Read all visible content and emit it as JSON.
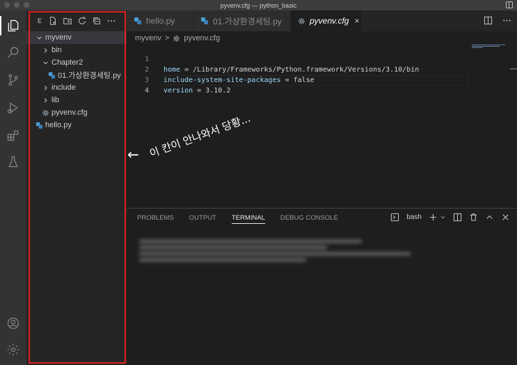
{
  "window": {
    "title": "pyvenv.cfg — python_basic"
  },
  "sidebar": {
    "header_letter": "E",
    "tree": [
      {
        "label": "myvenv",
        "indent": 0,
        "kind": "folder-open"
      },
      {
        "label": "bin",
        "indent": 1,
        "kind": "folder"
      },
      {
        "label": "Chapter2",
        "indent": 1,
        "kind": "folder-open"
      },
      {
        "label": "01.가상환경세팅.py",
        "indent": 2,
        "kind": "python"
      },
      {
        "label": "include",
        "indent": 1,
        "kind": "folder"
      },
      {
        "label": "lib",
        "indent": 1,
        "kind": "folder"
      },
      {
        "label": "pyvenv.cfg",
        "indent": 1,
        "kind": "gear"
      },
      {
        "label": "hello.py",
        "indent": 0,
        "kind": "python"
      }
    ]
  },
  "tabs": [
    {
      "label": "hello.py",
      "icon": "python-icon"
    },
    {
      "label": "01.가상환경세팅.py",
      "icon": "python-icon"
    },
    {
      "label": "pyvenv.cfg",
      "icon": "gear-icon",
      "close": "×"
    }
  ],
  "breadcrumb": {
    "folder": "myvenv",
    "sep": ">",
    "file": "pyvenv.cfg"
  },
  "editor": {
    "lines": [
      {
        "num": "1",
        "key": "home",
        "op": " = ",
        "val": "/Library/Frameworks/Python.framework/Versions/3.10/bin"
      },
      {
        "num": "2",
        "key": "include-system-site-packages",
        "op": " = ",
        "val": "false"
      },
      {
        "num": "3",
        "key": "version",
        "op": " = ",
        "val": "3.10.2"
      },
      {
        "num": "4",
        "key": "",
        "op": "",
        "val": ""
      }
    ]
  },
  "panel": {
    "tabs": [
      "PROBLEMS",
      "OUTPUT",
      "TERMINAL",
      "DEBUG CONSOLE"
    ],
    "active_tab": "TERMINAL",
    "shell": "bash"
  },
  "annotation": {
    "arrow": "←",
    "text": "이 칸이 안나와서 당황..."
  },
  "colors": {
    "highlight_border": "#e02020",
    "python_icon": "#4b9ed6",
    "accent": "#007acc"
  }
}
